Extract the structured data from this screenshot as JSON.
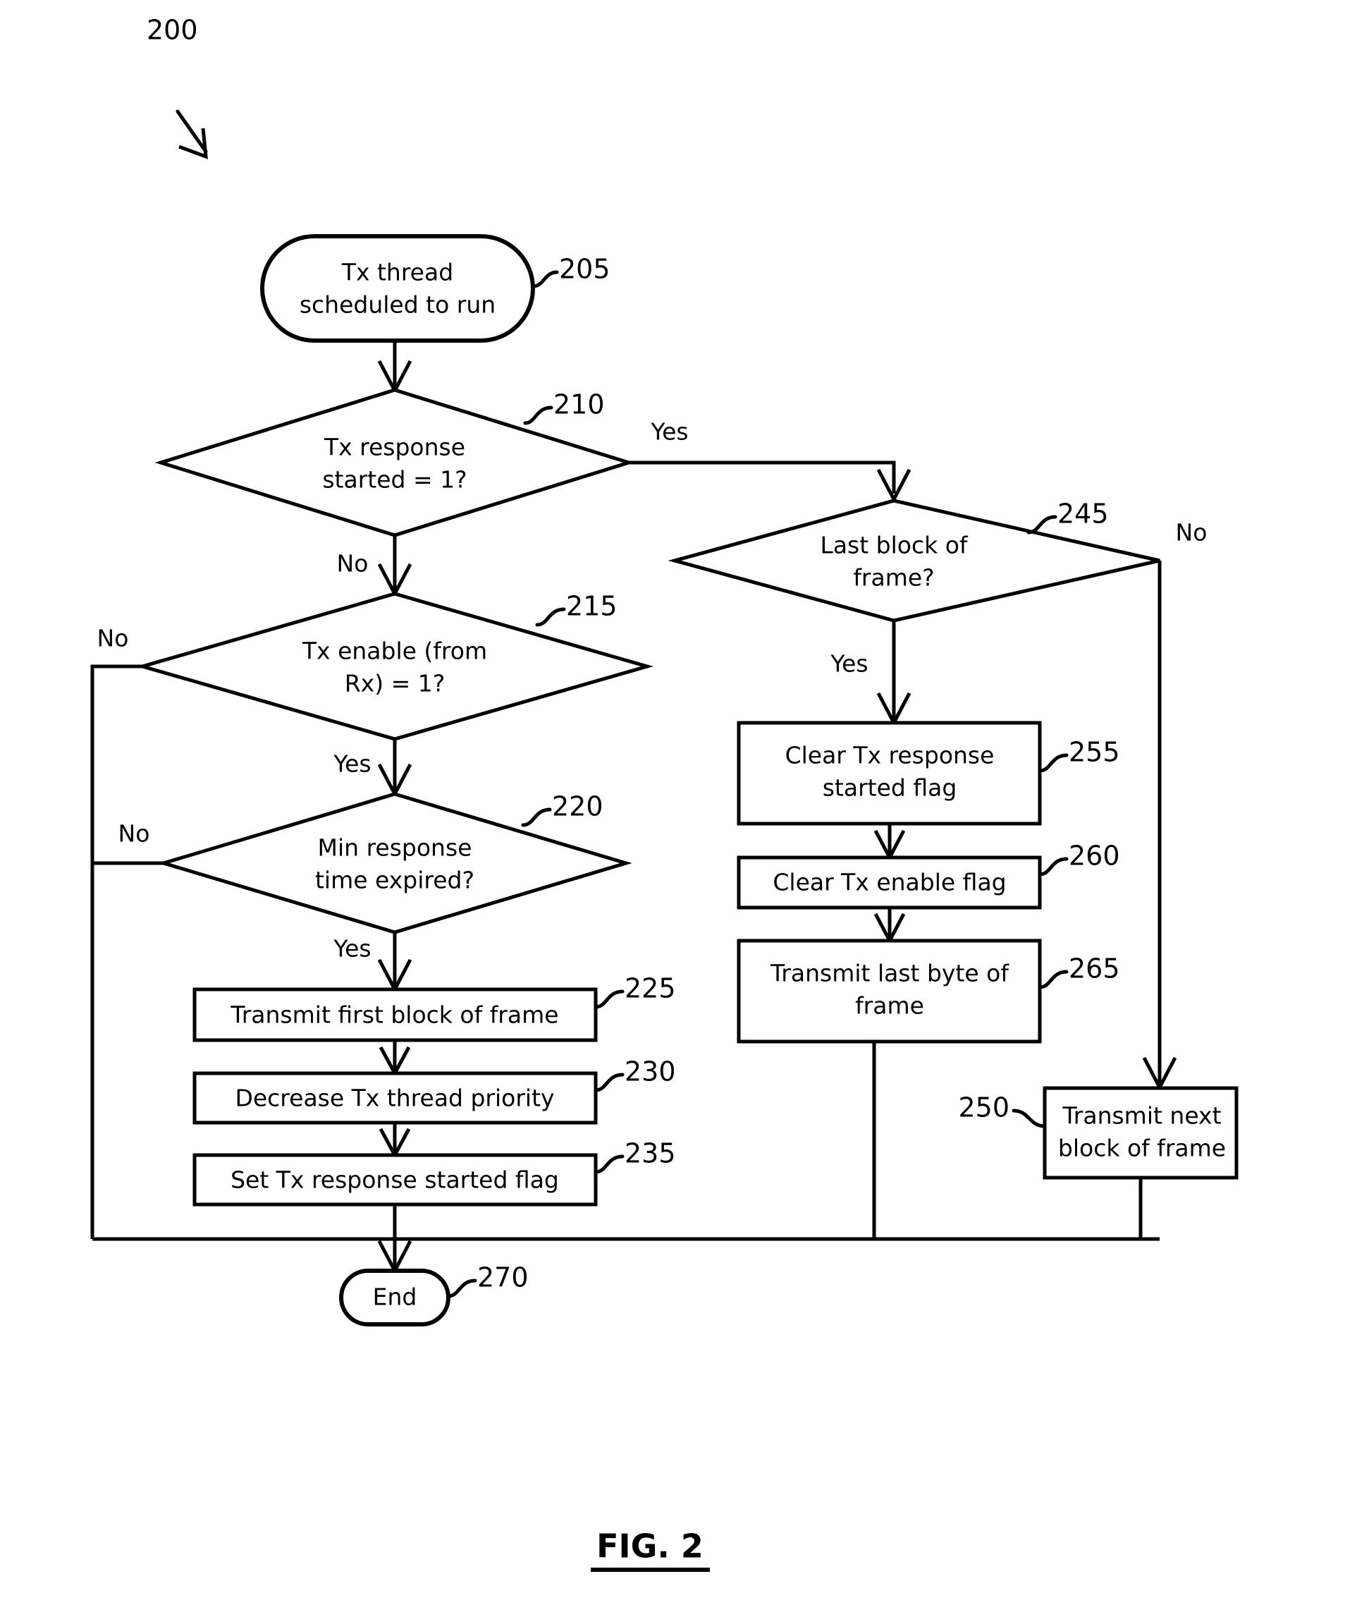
{
  "figure": {
    "caption": "FIG. 2",
    "diagram_ref": "200"
  },
  "nodes": {
    "start": {
      "ref": "205",
      "line1": "Tx thread",
      "line2": "scheduled to run"
    },
    "d210": {
      "ref": "210",
      "line1": "Tx response",
      "line2": "started = 1?"
    },
    "d215": {
      "ref": "215",
      "line1": "Tx enable (from",
      "line2": "Rx) = 1?"
    },
    "d220": {
      "ref": "220",
      "line1": "Min response",
      "line2": "time expired?"
    },
    "p225": {
      "ref": "225",
      "line1": "Transmit first block of frame"
    },
    "p230": {
      "ref": "230",
      "line1": "Decrease Tx thread priority"
    },
    "p235": {
      "ref": "235",
      "line1": "Set Tx response started flag"
    },
    "d245": {
      "ref": "245",
      "line1": "Last block of",
      "line2": "frame?"
    },
    "p250": {
      "ref": "250",
      "line1": "Transmit next",
      "line2": "block of frame"
    },
    "p255": {
      "ref": "255",
      "line1": "Clear Tx response",
      "line2": "started flag"
    },
    "p260": {
      "ref": "260",
      "line1": "Clear Tx enable flag"
    },
    "p265": {
      "ref": "265",
      "line1": "Transmit last byte of",
      "line2": "frame"
    },
    "end": {
      "ref": "270",
      "line1": "End"
    }
  },
  "branch_labels": {
    "d210_yes": "Yes",
    "d210_no": "No",
    "d215_no": "No",
    "d215_yes": "Yes",
    "d220_no": "No",
    "d220_yes": "Yes",
    "d245_no": "No",
    "d245_yes": "Yes"
  },
  "chart_data": {
    "type": "diagram",
    "title": "FIG. 2",
    "diagram_kind": "flowchart",
    "diagram_ref": "200",
    "steps": [
      {
        "ref": "205",
        "shape": "terminator",
        "text": "Tx thread scheduled to run"
      },
      {
        "ref": "210",
        "shape": "decision",
        "text": "Tx response started = 1?"
      },
      {
        "ref": "215",
        "shape": "decision",
        "text": "Tx enable (from Rx) = 1?"
      },
      {
        "ref": "220",
        "shape": "decision",
        "text": "Min response time expired?"
      },
      {
        "ref": "225",
        "shape": "process",
        "text": "Transmit first block of frame"
      },
      {
        "ref": "230",
        "shape": "process",
        "text": "Decrease Tx thread priority"
      },
      {
        "ref": "235",
        "shape": "process",
        "text": "Set Tx response started flag"
      },
      {
        "ref": "245",
        "shape": "decision",
        "text": "Last block of frame?"
      },
      {
        "ref": "250",
        "shape": "process",
        "text": "Transmit next block of frame"
      },
      {
        "ref": "255",
        "shape": "process",
        "text": "Clear Tx response started flag"
      },
      {
        "ref": "260",
        "shape": "process",
        "text": "Clear Tx enable flag"
      },
      {
        "ref": "265",
        "shape": "process",
        "text": "Transmit last byte of frame"
      },
      {
        "ref": "270",
        "shape": "terminator",
        "text": "End"
      }
    ],
    "edges": [
      {
        "from": "205",
        "to": "210",
        "label": ""
      },
      {
        "from": "210",
        "to": "245",
        "label": "Yes"
      },
      {
        "from": "210",
        "to": "215",
        "label": "No"
      },
      {
        "from": "215",
        "to": "270",
        "label": "No"
      },
      {
        "from": "215",
        "to": "220",
        "label": "Yes"
      },
      {
        "from": "220",
        "to": "270",
        "label": "No"
      },
      {
        "from": "220",
        "to": "225",
        "label": "Yes"
      },
      {
        "from": "225",
        "to": "230",
        "label": ""
      },
      {
        "from": "230",
        "to": "235",
        "label": ""
      },
      {
        "from": "235",
        "to": "270",
        "label": ""
      },
      {
        "from": "245",
        "to": "250",
        "label": "No"
      },
      {
        "from": "245",
        "to": "255",
        "label": "Yes"
      },
      {
        "from": "255",
        "to": "260",
        "label": ""
      },
      {
        "from": "260",
        "to": "265",
        "label": ""
      },
      {
        "from": "265",
        "to": "270",
        "label": ""
      },
      {
        "from": "250",
        "to": "270",
        "label": ""
      }
    ]
  }
}
